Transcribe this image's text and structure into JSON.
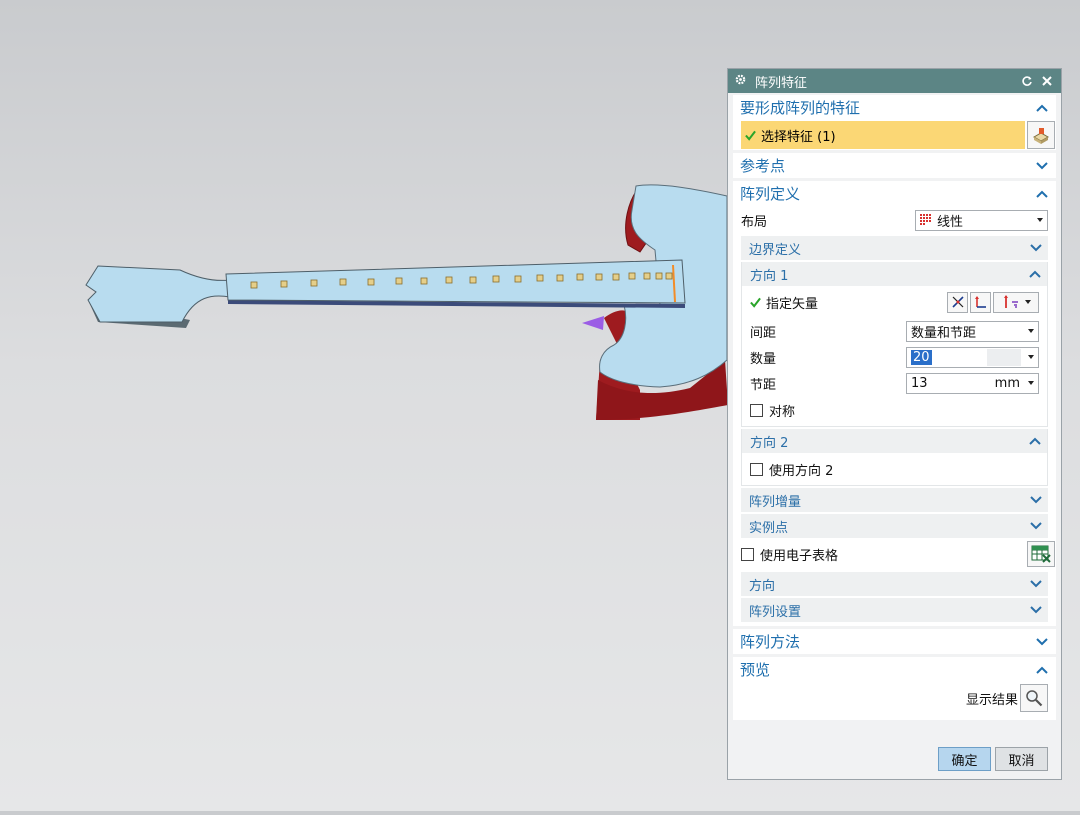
{
  "dialog": {
    "title": "阵列特征",
    "colors": {
      "titlebar": "#5c8585",
      "accent": "#1f6fae",
      "highlight": "#fbd775"
    },
    "section_features": {
      "title": "要形成阵列的特征",
      "select_label": "选择特征 (1)"
    },
    "section_reference": {
      "title": "参考点"
    },
    "section_definition": {
      "title": "阵列定义",
      "layout_label": "布局",
      "layout_value": "线性",
      "boundary_title": "边界定义",
      "direction1": {
        "title": "方向 1",
        "vector_label": "指定矢量",
        "spacing_label": "间距",
        "spacing_value": "数量和节距",
        "count_label": "数量",
        "count_value": "20",
        "pitch_label": "节距",
        "pitch_value": "13",
        "pitch_unit": "mm",
        "symmetric_label": "对称"
      },
      "direction2": {
        "title": "方向 2",
        "use_label": "使用方向 2"
      },
      "increment_title": "阵列增量",
      "instance_title": "实例点",
      "spreadsheet_label": "使用电子表格",
      "orientation_title": "方向",
      "settings_title": "阵列设置"
    },
    "section_method": {
      "title": "阵列方法"
    },
    "section_preview": {
      "title": "预览",
      "show_result_label": "显示结果"
    },
    "ok_label": "确定",
    "cancel_label": "取消"
  }
}
